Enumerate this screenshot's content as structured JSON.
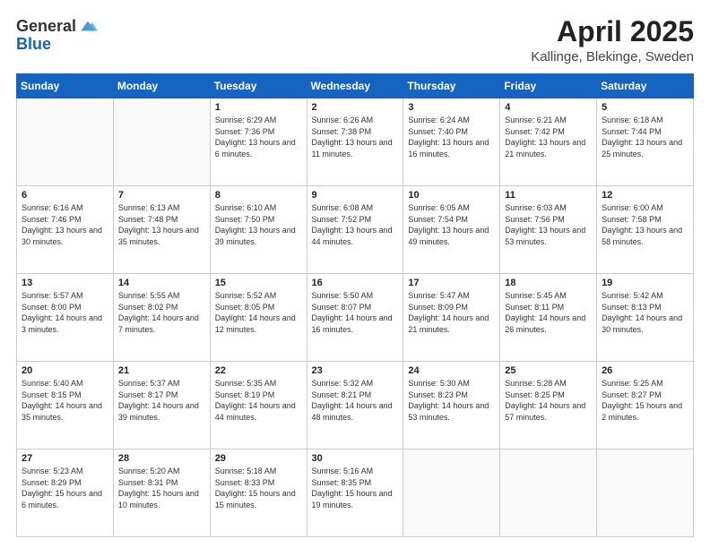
{
  "header": {
    "logo_general": "General",
    "logo_blue": "Blue",
    "title": "April 2025",
    "location": "Kallinge, Blekinge, Sweden"
  },
  "weekdays": [
    "Sunday",
    "Monday",
    "Tuesday",
    "Wednesday",
    "Thursday",
    "Friday",
    "Saturday"
  ],
  "weeks": [
    [
      {
        "day": "",
        "sunrise": "",
        "sunset": "",
        "daylight": ""
      },
      {
        "day": "",
        "sunrise": "",
        "sunset": "",
        "daylight": ""
      },
      {
        "day": "1",
        "sunrise": "Sunrise: 6:29 AM",
        "sunset": "Sunset: 7:36 PM",
        "daylight": "Daylight: 13 hours and 6 minutes."
      },
      {
        "day": "2",
        "sunrise": "Sunrise: 6:26 AM",
        "sunset": "Sunset: 7:38 PM",
        "daylight": "Daylight: 13 hours and 11 minutes."
      },
      {
        "day": "3",
        "sunrise": "Sunrise: 6:24 AM",
        "sunset": "Sunset: 7:40 PM",
        "daylight": "Daylight: 13 hours and 16 minutes."
      },
      {
        "day": "4",
        "sunrise": "Sunrise: 6:21 AM",
        "sunset": "Sunset: 7:42 PM",
        "daylight": "Daylight: 13 hours and 21 minutes."
      },
      {
        "day": "5",
        "sunrise": "Sunrise: 6:18 AM",
        "sunset": "Sunset: 7:44 PM",
        "daylight": "Daylight: 13 hours and 25 minutes."
      }
    ],
    [
      {
        "day": "6",
        "sunrise": "Sunrise: 6:16 AM",
        "sunset": "Sunset: 7:46 PM",
        "daylight": "Daylight: 13 hours and 30 minutes."
      },
      {
        "day": "7",
        "sunrise": "Sunrise: 6:13 AM",
        "sunset": "Sunset: 7:48 PM",
        "daylight": "Daylight: 13 hours and 35 minutes."
      },
      {
        "day": "8",
        "sunrise": "Sunrise: 6:10 AM",
        "sunset": "Sunset: 7:50 PM",
        "daylight": "Daylight: 13 hours and 39 minutes."
      },
      {
        "day": "9",
        "sunrise": "Sunrise: 6:08 AM",
        "sunset": "Sunset: 7:52 PM",
        "daylight": "Daylight: 13 hours and 44 minutes."
      },
      {
        "day": "10",
        "sunrise": "Sunrise: 6:05 AM",
        "sunset": "Sunset: 7:54 PM",
        "daylight": "Daylight: 13 hours and 49 minutes."
      },
      {
        "day": "11",
        "sunrise": "Sunrise: 6:03 AM",
        "sunset": "Sunset: 7:56 PM",
        "daylight": "Daylight: 13 hours and 53 minutes."
      },
      {
        "day": "12",
        "sunrise": "Sunrise: 6:00 AM",
        "sunset": "Sunset: 7:58 PM",
        "daylight": "Daylight: 13 hours and 58 minutes."
      }
    ],
    [
      {
        "day": "13",
        "sunrise": "Sunrise: 5:57 AM",
        "sunset": "Sunset: 8:00 PM",
        "daylight": "Daylight: 14 hours and 3 minutes."
      },
      {
        "day": "14",
        "sunrise": "Sunrise: 5:55 AM",
        "sunset": "Sunset: 8:02 PM",
        "daylight": "Daylight: 14 hours and 7 minutes."
      },
      {
        "day": "15",
        "sunrise": "Sunrise: 5:52 AM",
        "sunset": "Sunset: 8:05 PM",
        "daylight": "Daylight: 14 hours and 12 minutes."
      },
      {
        "day": "16",
        "sunrise": "Sunrise: 5:50 AM",
        "sunset": "Sunset: 8:07 PM",
        "daylight": "Daylight: 14 hours and 16 minutes."
      },
      {
        "day": "17",
        "sunrise": "Sunrise: 5:47 AM",
        "sunset": "Sunset: 8:09 PM",
        "daylight": "Daylight: 14 hours and 21 minutes."
      },
      {
        "day": "18",
        "sunrise": "Sunrise: 5:45 AM",
        "sunset": "Sunset: 8:11 PM",
        "daylight": "Daylight: 14 hours and 26 minutes."
      },
      {
        "day": "19",
        "sunrise": "Sunrise: 5:42 AM",
        "sunset": "Sunset: 8:13 PM",
        "daylight": "Daylight: 14 hours and 30 minutes."
      }
    ],
    [
      {
        "day": "20",
        "sunrise": "Sunrise: 5:40 AM",
        "sunset": "Sunset: 8:15 PM",
        "daylight": "Daylight: 14 hours and 35 minutes."
      },
      {
        "day": "21",
        "sunrise": "Sunrise: 5:37 AM",
        "sunset": "Sunset: 8:17 PM",
        "daylight": "Daylight: 14 hours and 39 minutes."
      },
      {
        "day": "22",
        "sunrise": "Sunrise: 5:35 AM",
        "sunset": "Sunset: 8:19 PM",
        "daylight": "Daylight: 14 hours and 44 minutes."
      },
      {
        "day": "23",
        "sunrise": "Sunrise: 5:32 AM",
        "sunset": "Sunset: 8:21 PM",
        "daylight": "Daylight: 14 hours and 48 minutes."
      },
      {
        "day": "24",
        "sunrise": "Sunrise: 5:30 AM",
        "sunset": "Sunset: 8:23 PM",
        "daylight": "Daylight: 14 hours and 53 minutes."
      },
      {
        "day": "25",
        "sunrise": "Sunrise: 5:28 AM",
        "sunset": "Sunset: 8:25 PM",
        "daylight": "Daylight: 14 hours and 57 minutes."
      },
      {
        "day": "26",
        "sunrise": "Sunrise: 5:25 AM",
        "sunset": "Sunset: 8:27 PM",
        "daylight": "Daylight: 15 hours and 2 minutes."
      }
    ],
    [
      {
        "day": "27",
        "sunrise": "Sunrise: 5:23 AM",
        "sunset": "Sunset: 8:29 PM",
        "daylight": "Daylight: 15 hours and 6 minutes."
      },
      {
        "day": "28",
        "sunrise": "Sunrise: 5:20 AM",
        "sunset": "Sunset: 8:31 PM",
        "daylight": "Daylight: 15 hours and 10 minutes."
      },
      {
        "day": "29",
        "sunrise": "Sunrise: 5:18 AM",
        "sunset": "Sunset: 8:33 PM",
        "daylight": "Daylight: 15 hours and 15 minutes."
      },
      {
        "day": "30",
        "sunrise": "Sunrise: 5:16 AM",
        "sunset": "Sunset: 8:35 PM",
        "daylight": "Daylight: 15 hours and 19 minutes."
      },
      {
        "day": "",
        "sunrise": "",
        "sunset": "",
        "daylight": ""
      },
      {
        "day": "",
        "sunrise": "",
        "sunset": "",
        "daylight": ""
      },
      {
        "day": "",
        "sunrise": "",
        "sunset": "",
        "daylight": ""
      }
    ]
  ]
}
